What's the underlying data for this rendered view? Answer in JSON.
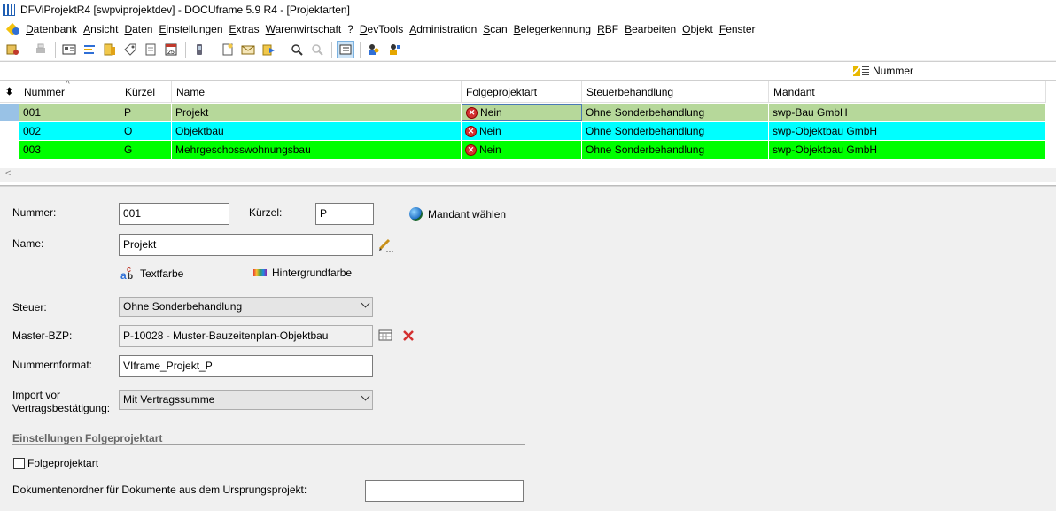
{
  "window": {
    "title": "DFViProjektR4 [swpviprojektdev] - DOCUframe 5.9 R4 - [Projektarten]"
  },
  "menu": {
    "items": [
      "Datenbank",
      "Ansicht",
      "Daten",
      "Einstellungen",
      "Extras",
      "Warenwirtschaft",
      "?",
      "DevTools",
      "Administration",
      "Scan",
      "Belegerkennung",
      "RBF",
      "Bearbeiten",
      "Objekt",
      "Fenster"
    ]
  },
  "filter": {
    "sort_column": "Nummer"
  },
  "grid": {
    "columns": [
      "Nummer",
      "Kürzel",
      "Name",
      "Folgeprojektart",
      "Steuerbehandlung",
      "Mandant"
    ],
    "rows": [
      {
        "nummer": "001",
        "kuerzel": "P",
        "name": "Projekt",
        "folge": "Nein",
        "steuer": "Ohne Sonderbehandlung",
        "mandant": "swp-Bau GmbH",
        "bg": "#b6d89a"
      },
      {
        "nummer": "002",
        "kuerzel": "O",
        "name": "Objektbau",
        "folge": "Nein",
        "steuer": "Ohne Sonderbehandlung",
        "mandant": "swp-Objektbau GmbH",
        "bg": "#00ffff"
      },
      {
        "nummer": "003",
        "kuerzel": "G",
        "name": "Mehrgeschosswohnungsbau",
        "folge": "Nein",
        "steuer": "Ohne Sonderbehandlung",
        "mandant": "swp-Objektbau GmbH",
        "bg": "#00ff00"
      }
    ]
  },
  "form": {
    "nummer_label": "Nummer:",
    "nummer_value": "001",
    "kuerzel_label": "Kürzel:",
    "kuerzel_value": "P",
    "mandant_button": "Mandant wählen",
    "name_label": "Name:",
    "name_value": "Projekt",
    "textfarbe": "Textfarbe",
    "hintergrundfarbe": "Hintergrundfarbe",
    "steuer_label": "Steuer:",
    "steuer_value": "Ohne Sonderbehandlung",
    "master_label": "Master-BZP:",
    "master_value": "P-10028 - Muster-Bauzeitenplan-Objektbau",
    "nummernformat_label": "Nummernformat:",
    "nummernformat_value": "VIframe_Projekt_P",
    "import_label_1": "Import vor",
    "import_label_2": "Vertragsbestätigung:",
    "import_value": "Mit Vertragssumme",
    "section_title": "Einstellungen Folgeprojektart",
    "folge_checkbox_label": "Folgeprojektart",
    "dokumentenordner_label": "Dokumentenordner für Dokumente aus dem Ursprungsprojekt:",
    "dokumentenordner_value": ""
  }
}
